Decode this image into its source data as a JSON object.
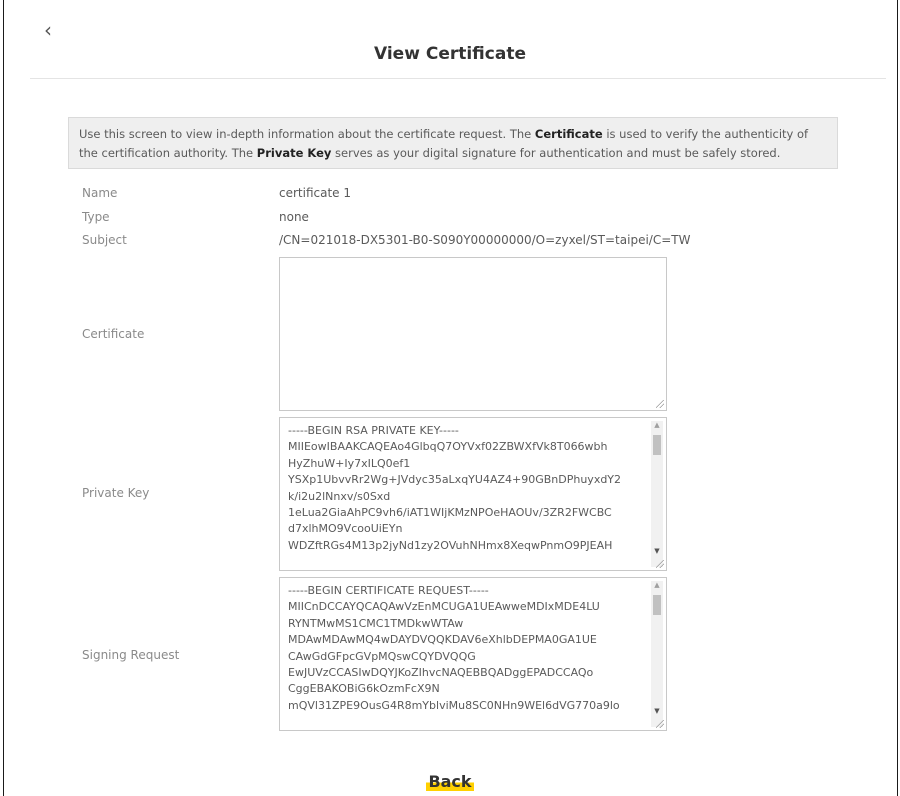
{
  "header": {
    "back_icon": "‹",
    "title": "View Certificate"
  },
  "info": {
    "p1": "Use this screen to view in-depth information about the certificate request. The ",
    "b1": "Certificate",
    "p2": " is used to verify the authenticity of the certification authority. The ",
    "b2": "Private Key",
    "p3": " serves as your digital signature for authentication and must be safely stored."
  },
  "fields": {
    "name": {
      "label": "Name",
      "value": "certificate 1"
    },
    "type": {
      "label": "Type",
      "value": "none"
    },
    "subject": {
      "label": "Subject",
      "value": "/CN=021018-DX5301-B0-S090Y00000000/O=zyxel/ST=taipei/C=TW"
    },
    "certificate": {
      "label": "Certificate",
      "value": ""
    },
    "private_key": {
      "label": "Private Key",
      "value": "-----BEGIN RSA PRIVATE KEY-----\nMIIEowIBAAKCAQEAo4GlbqQ7OYVxf02ZBWXfVk8T066wbh\nHyZhuW+Iy7xILQ0ef1\nYSXp1UbvvRr2Wg+JVdyc35aLxqYU4AZ4+90GBnDPhuyxdY2\nk/i2u2lNnxv/s0Sxd\n1eLua2GiaAhPC9vh6/iAT1WIjKMzNPOeHAOUv/3ZR2FWCBC\nd7xlhMO9VcooUiEYn\nWDZftRGs4M13p2jyNd1zy2OVuhNHmx8XeqwPnmO9PJEAH"
    },
    "signing_request": {
      "label": "Signing Request",
      "value": "-----BEGIN CERTIFICATE REQUEST-----\nMIICnDCCAYQCAQAwVzEnMCUGA1UEAwweMDIxMDE4LU\nRYNTMwMS1CMC1TMDkwWTAw\nMDAwMDAwMQ4wDAYDVQQKDAV6eXhlbDEPMA0GA1UE\nCAwGdGFpcGVpMQswCQYDVQQG\nEwJUVzCCASIwDQYJKoZIhvcNAQEBBQADggEPADCCAQo\nCggEBAKOBiG6kOzmFcX9N\nmQVl31ZPE9OusG4R8mYblviMu8SC0NHn9WEl6dVG770a9lo"
    }
  },
  "footer": {
    "back_label": "Back"
  },
  "colors": {
    "accent": "#ffd000",
    "info_bg": "#efefef"
  }
}
